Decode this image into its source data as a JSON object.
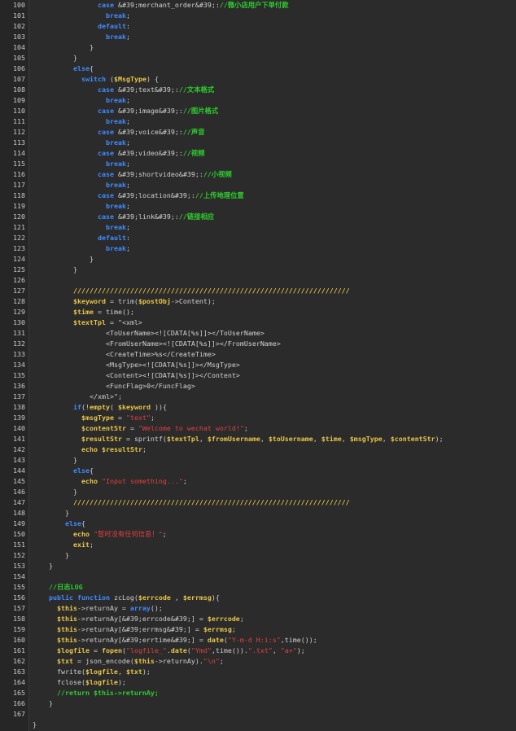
{
  "editor": {
    "lines": [
      {
        "n": "100",
        "indent": 8,
        "tokens": [
          [
            "kw",
            "case"
          ],
          [
            "fn",
            " &#39;merchant_order&#39;:"
          ],
          [
            "cmt",
            "//微小店用户下单付款"
          ]
        ]
      },
      {
        "n": "101",
        "indent": 9,
        "tokens": [
          [
            "kw",
            "break"
          ],
          [
            "fn",
            ";"
          ]
        ]
      },
      {
        "n": "102",
        "indent": 8,
        "tokens": [
          [
            "kw",
            "default"
          ],
          [
            "fn",
            ":"
          ]
        ]
      },
      {
        "n": "103",
        "indent": 9,
        "tokens": [
          [
            "kw",
            "break"
          ],
          [
            "fn",
            ";"
          ]
        ]
      },
      {
        "n": "104",
        "indent": 7,
        "tokens": [
          [
            "br",
            "}"
          ]
        ]
      },
      {
        "n": "105",
        "indent": 5,
        "tokens": [
          [
            "br",
            "}"
          ]
        ]
      },
      {
        "n": "106",
        "indent": 5,
        "tokens": [
          [
            "kw",
            "else"
          ],
          [
            "br",
            "{"
          ]
        ]
      },
      {
        "n": "107",
        "indent": 6,
        "tokens": [
          [
            "kw",
            "switch"
          ],
          [
            "fn",
            " ("
          ],
          [
            "var",
            "$MsgType"
          ],
          [
            "fn",
            ") {"
          ]
        ]
      },
      {
        "n": "108",
        "indent": 8,
        "tokens": [
          [
            "kw",
            "case"
          ],
          [
            "fn",
            " &#39;text&#39;:"
          ],
          [
            "cmt",
            "//文本格式"
          ]
        ]
      },
      {
        "n": "109",
        "indent": 9,
        "tokens": [
          [
            "kw",
            "break"
          ],
          [
            "fn",
            ";"
          ]
        ]
      },
      {
        "n": "110",
        "indent": 8,
        "tokens": [
          [
            "kw",
            "case"
          ],
          [
            "fn",
            " &#39;image&#39;:"
          ],
          [
            "cmt",
            "//图片格式"
          ]
        ]
      },
      {
        "n": "111",
        "indent": 9,
        "tokens": [
          [
            "kw",
            "break"
          ],
          [
            "fn",
            ";"
          ]
        ]
      },
      {
        "n": "112",
        "indent": 8,
        "tokens": [
          [
            "kw",
            "case"
          ],
          [
            "fn",
            " &#39;voice&#39;:"
          ],
          [
            "cmt",
            "//声音"
          ]
        ]
      },
      {
        "n": "113",
        "indent": 9,
        "tokens": [
          [
            "kw",
            "break"
          ],
          [
            "fn",
            ";"
          ]
        ]
      },
      {
        "n": "114",
        "indent": 8,
        "tokens": [
          [
            "kw",
            "case"
          ],
          [
            "fn",
            " &#39;video&#39;:"
          ],
          [
            "cmt",
            "//视频"
          ]
        ]
      },
      {
        "n": "115",
        "indent": 9,
        "tokens": [
          [
            "kw",
            "break"
          ],
          [
            "fn",
            ";"
          ]
        ]
      },
      {
        "n": "116",
        "indent": 8,
        "tokens": [
          [
            "kw",
            "case"
          ],
          [
            "fn",
            " &#39;shortvideo&#39;:"
          ],
          [
            "cmt",
            "//小视频"
          ]
        ]
      },
      {
        "n": "117",
        "indent": 9,
        "tokens": [
          [
            "kw",
            "break"
          ],
          [
            "fn",
            ";"
          ]
        ]
      },
      {
        "n": "118",
        "indent": 8,
        "tokens": [
          [
            "kw",
            "case"
          ],
          [
            "fn",
            " &#39;location&#39;:"
          ],
          [
            "cmt",
            "//上传地理位置"
          ]
        ]
      },
      {
        "n": "119",
        "indent": 9,
        "tokens": [
          [
            "kw",
            "break"
          ],
          [
            "fn",
            ";"
          ]
        ]
      },
      {
        "n": "120",
        "indent": 8,
        "tokens": [
          [
            "kw",
            "case"
          ],
          [
            "fn",
            " &#39;link&#39;:"
          ],
          [
            "cmt",
            "//链接相应"
          ]
        ]
      },
      {
        "n": "121",
        "indent": 9,
        "tokens": [
          [
            "kw",
            "break"
          ],
          [
            "fn",
            ";"
          ]
        ]
      },
      {
        "n": "122",
        "indent": 8,
        "tokens": [
          [
            "kw",
            "default"
          ],
          [
            "fn",
            ":"
          ]
        ]
      },
      {
        "n": "123",
        "indent": 9,
        "tokens": [
          [
            "kw",
            "break"
          ],
          [
            "fn",
            ";"
          ]
        ]
      },
      {
        "n": "124",
        "indent": 7,
        "tokens": [
          [
            "br",
            "}"
          ]
        ]
      },
      {
        "n": "125",
        "indent": 5,
        "tokens": [
          [
            "br",
            "}"
          ]
        ]
      },
      {
        "n": "126",
        "indent": 0,
        "tokens": []
      },
      {
        "n": "127",
        "indent": 5,
        "tokens": [
          [
            "var",
            "////////////////////////////////////////////////////////////////////"
          ]
        ]
      },
      {
        "n": "128",
        "indent": 5,
        "tokens": [
          [
            "var",
            "$keyword"
          ],
          [
            "fn",
            " = trim("
          ],
          [
            "var",
            "$postObj"
          ],
          [
            "fn",
            "->Content);"
          ]
        ]
      },
      {
        "n": "129",
        "indent": 5,
        "tokens": [
          [
            "var",
            "$time"
          ],
          [
            "fn",
            " = time();"
          ]
        ]
      },
      {
        "n": "130",
        "indent": 5,
        "tokens": [
          [
            "var",
            "$textTpl"
          ],
          [
            "fn",
            " = \"<xml>"
          ]
        ]
      },
      {
        "n": "131",
        "indent": 9,
        "tokens": [
          [
            "fn",
            "<ToUserName><![CDATA[%s]]></ToUserName>"
          ]
        ]
      },
      {
        "n": "132",
        "indent": 9,
        "tokens": [
          [
            "fn",
            "<FromUserName><![CDATA[%s]]></FromUserName>"
          ]
        ]
      },
      {
        "n": "133",
        "indent": 9,
        "tokens": [
          [
            "fn",
            "<CreateTime>%s</CreateTime>"
          ]
        ]
      },
      {
        "n": "134",
        "indent": 9,
        "tokens": [
          [
            "fn",
            "<MsgType><![CDATA[%s]]></MsgType>"
          ]
        ]
      },
      {
        "n": "135",
        "indent": 9,
        "tokens": [
          [
            "fn",
            "<Content><![CDATA[%s]]></Content>"
          ]
        ]
      },
      {
        "n": "136",
        "indent": 9,
        "tokens": [
          [
            "fn",
            "<FuncFlag>0</FuncFlag>"
          ]
        ]
      },
      {
        "n": "137",
        "indent": 7,
        "tokens": [
          [
            "fn",
            "</xml>\";"
          ]
        ]
      },
      {
        "n": "138",
        "indent": 5,
        "tokens": [
          [
            "kw",
            "if"
          ],
          [
            "fn",
            "(!"
          ],
          [
            "kw2",
            "empty"
          ],
          [
            "fn",
            "( "
          ],
          [
            "var",
            "$keyword"
          ],
          [
            "fn",
            " )){"
          ]
        ]
      },
      {
        "n": "139",
        "indent": 6,
        "tokens": [
          [
            "var",
            "$msgType"
          ],
          [
            "fn",
            " = "
          ],
          [
            "str",
            "\"text\""
          ],
          [
            "fn",
            ";"
          ]
        ]
      },
      {
        "n": "140",
        "indent": 6,
        "tokens": [
          [
            "var",
            "$contentStr"
          ],
          [
            "fn",
            " = "
          ],
          [
            "str",
            "\"Welcome to wechat world!\""
          ],
          [
            "fn",
            ";"
          ]
        ]
      },
      {
        "n": "141",
        "indent": 6,
        "tokens": [
          [
            "var",
            "$resultStr"
          ],
          [
            "fn",
            " = sprintf("
          ],
          [
            "var",
            "$textTpl"
          ],
          [
            "fn",
            ", "
          ],
          [
            "var",
            "$fromUsername"
          ],
          [
            "fn",
            ", "
          ],
          [
            "var",
            "$toUsername"
          ],
          [
            "fn",
            ", "
          ],
          [
            "var",
            "$time"
          ],
          [
            "fn",
            ", "
          ],
          [
            "var",
            "$msgType"
          ],
          [
            "fn",
            ", "
          ],
          [
            "var",
            "$contentStr"
          ],
          [
            "fn",
            ");"
          ]
        ]
      },
      {
        "n": "142",
        "indent": 6,
        "tokens": [
          [
            "kw2",
            "echo"
          ],
          [
            "fn",
            " "
          ],
          [
            "var",
            "$resultStr"
          ],
          [
            "fn",
            ";"
          ]
        ]
      },
      {
        "n": "143",
        "indent": 5,
        "tokens": [
          [
            "br",
            "}"
          ]
        ]
      },
      {
        "n": "144",
        "indent": 5,
        "tokens": [
          [
            "kw",
            "else"
          ],
          [
            "br",
            "{"
          ]
        ]
      },
      {
        "n": "145",
        "indent": 6,
        "tokens": [
          [
            "kw2",
            "echo"
          ],
          [
            "fn",
            " "
          ],
          [
            "str",
            "\"Input something...\""
          ],
          [
            "fn",
            ";"
          ]
        ]
      },
      {
        "n": "146",
        "indent": 5,
        "tokens": [
          [
            "br",
            "}"
          ]
        ]
      },
      {
        "n": "147",
        "indent": 5,
        "tokens": [
          [
            "var",
            "////////////////////////////////////////////////////////////////////"
          ]
        ]
      },
      {
        "n": "148",
        "indent": 4,
        "tokens": [
          [
            "br",
            "}"
          ]
        ]
      },
      {
        "n": "149",
        "indent": 4,
        "tokens": [
          [
            "kw",
            "else"
          ],
          [
            "br",
            "{"
          ]
        ]
      },
      {
        "n": "150",
        "indent": 5,
        "tokens": [
          [
            "kw2",
            "echo"
          ],
          [
            "fn",
            " "
          ],
          [
            "str",
            "\"暂时没有任何信息！\""
          ],
          [
            "fn",
            ";"
          ]
        ]
      },
      {
        "n": "151",
        "indent": 5,
        "tokens": [
          [
            "kw2",
            "exit"
          ],
          [
            "fn",
            ";"
          ]
        ]
      },
      {
        "n": "152",
        "indent": 4,
        "tokens": [
          [
            "br",
            "}"
          ]
        ]
      },
      {
        "n": "153",
        "indent": 2,
        "tokens": [
          [
            "br",
            "}"
          ]
        ]
      },
      {
        "n": "154",
        "indent": 0,
        "tokens": []
      },
      {
        "n": "155",
        "indent": 2,
        "tokens": [
          [
            "cmt",
            "//日志LOG"
          ]
        ]
      },
      {
        "n": "156",
        "indent": 2,
        "tokens": [
          [
            "kw",
            "public"
          ],
          [
            "fn",
            " "
          ],
          [
            "kw",
            "function"
          ],
          [
            "fn",
            " zcLog("
          ],
          [
            "var",
            "$errcode"
          ],
          [
            "fn",
            " , "
          ],
          [
            "var",
            "$errmsg"
          ],
          [
            "fn",
            "){"
          ]
        ]
      },
      {
        "n": "157",
        "indent": 3,
        "tokens": [
          [
            "var",
            "$this"
          ],
          [
            "fn",
            "->returnAy = "
          ],
          [
            "kw",
            "array"
          ],
          [
            "fn",
            "();"
          ]
        ]
      },
      {
        "n": "158",
        "indent": 3,
        "tokens": [
          [
            "var",
            "$this"
          ],
          [
            "fn",
            "->returnAy[&#39;errcode&#39;] = "
          ],
          [
            "var",
            "$errcode"
          ],
          [
            "fn",
            ";"
          ]
        ]
      },
      {
        "n": "159",
        "indent": 3,
        "tokens": [
          [
            "var",
            "$this"
          ],
          [
            "fn",
            "->returnAy[&#39;errmsg&#39;] = "
          ],
          [
            "var",
            "$errmsg"
          ],
          [
            "fn",
            ";"
          ]
        ]
      },
      {
        "n": "160",
        "indent": 3,
        "tokens": [
          [
            "var",
            "$this"
          ],
          [
            "fn",
            "->returnAy[&#39;errtime&#39;] = "
          ],
          [
            "kw2",
            "date"
          ],
          [
            "fn",
            "("
          ],
          [
            "str",
            "\"Y-m-d H:i:s\""
          ],
          [
            "fn",
            ",time());"
          ]
        ]
      },
      {
        "n": "161",
        "indent": 3,
        "tokens": [
          [
            "var",
            "$logfile"
          ],
          [
            "fn",
            " = "
          ],
          [
            "kw2",
            "fopen"
          ],
          [
            "fn",
            "("
          ],
          [
            "str",
            "\"logfile_\""
          ],
          [
            "fn",
            "."
          ],
          [
            "kw2",
            "date"
          ],
          [
            "fn",
            "("
          ],
          [
            "str",
            "\"Ymd\""
          ],
          [
            "fn",
            ",time())."
          ],
          [
            "str",
            "\".txt\""
          ],
          [
            "fn",
            ", "
          ],
          [
            "str",
            "\"a+\""
          ],
          [
            "fn",
            ");"
          ]
        ]
      },
      {
        "n": "162",
        "indent": 3,
        "tokens": [
          [
            "var",
            "$txt"
          ],
          [
            "fn",
            " = json_encode("
          ],
          [
            "var",
            "$this"
          ],
          [
            "fn",
            "->returnAy)."
          ],
          [
            "str",
            "\"\\n\""
          ],
          [
            "fn",
            ";"
          ]
        ]
      },
      {
        "n": "163",
        "indent": 3,
        "tokens": [
          [
            "fn",
            "fwrite("
          ],
          [
            "var",
            "$logfile"
          ],
          [
            "fn",
            ", "
          ],
          [
            "var",
            "$txt"
          ],
          [
            "fn",
            ");"
          ]
        ]
      },
      {
        "n": "164",
        "indent": 3,
        "tokens": [
          [
            "fn",
            "fclose("
          ],
          [
            "var",
            "$logfile"
          ],
          [
            "fn",
            ");"
          ]
        ]
      },
      {
        "n": "165",
        "indent": 3,
        "tokens": [
          [
            "cmt",
            "//return $this->returnAy;"
          ]
        ]
      },
      {
        "n": "166",
        "indent": 2,
        "tokens": [
          [
            "br",
            "}"
          ]
        ]
      },
      {
        "n": "167",
        "indent": 0,
        "tokens": []
      },
      {
        "n": "",
        "indent": 0,
        "tokens": [
          [
            "br",
            "}"
          ]
        ]
      }
    ]
  },
  "colors": {
    "background": "#2b2b2b",
    "gutter": "#262626",
    "keyword": "#3f8bff",
    "variable": "#e8c547",
    "string": "#e04040",
    "comment": "#2ecc2e"
  }
}
